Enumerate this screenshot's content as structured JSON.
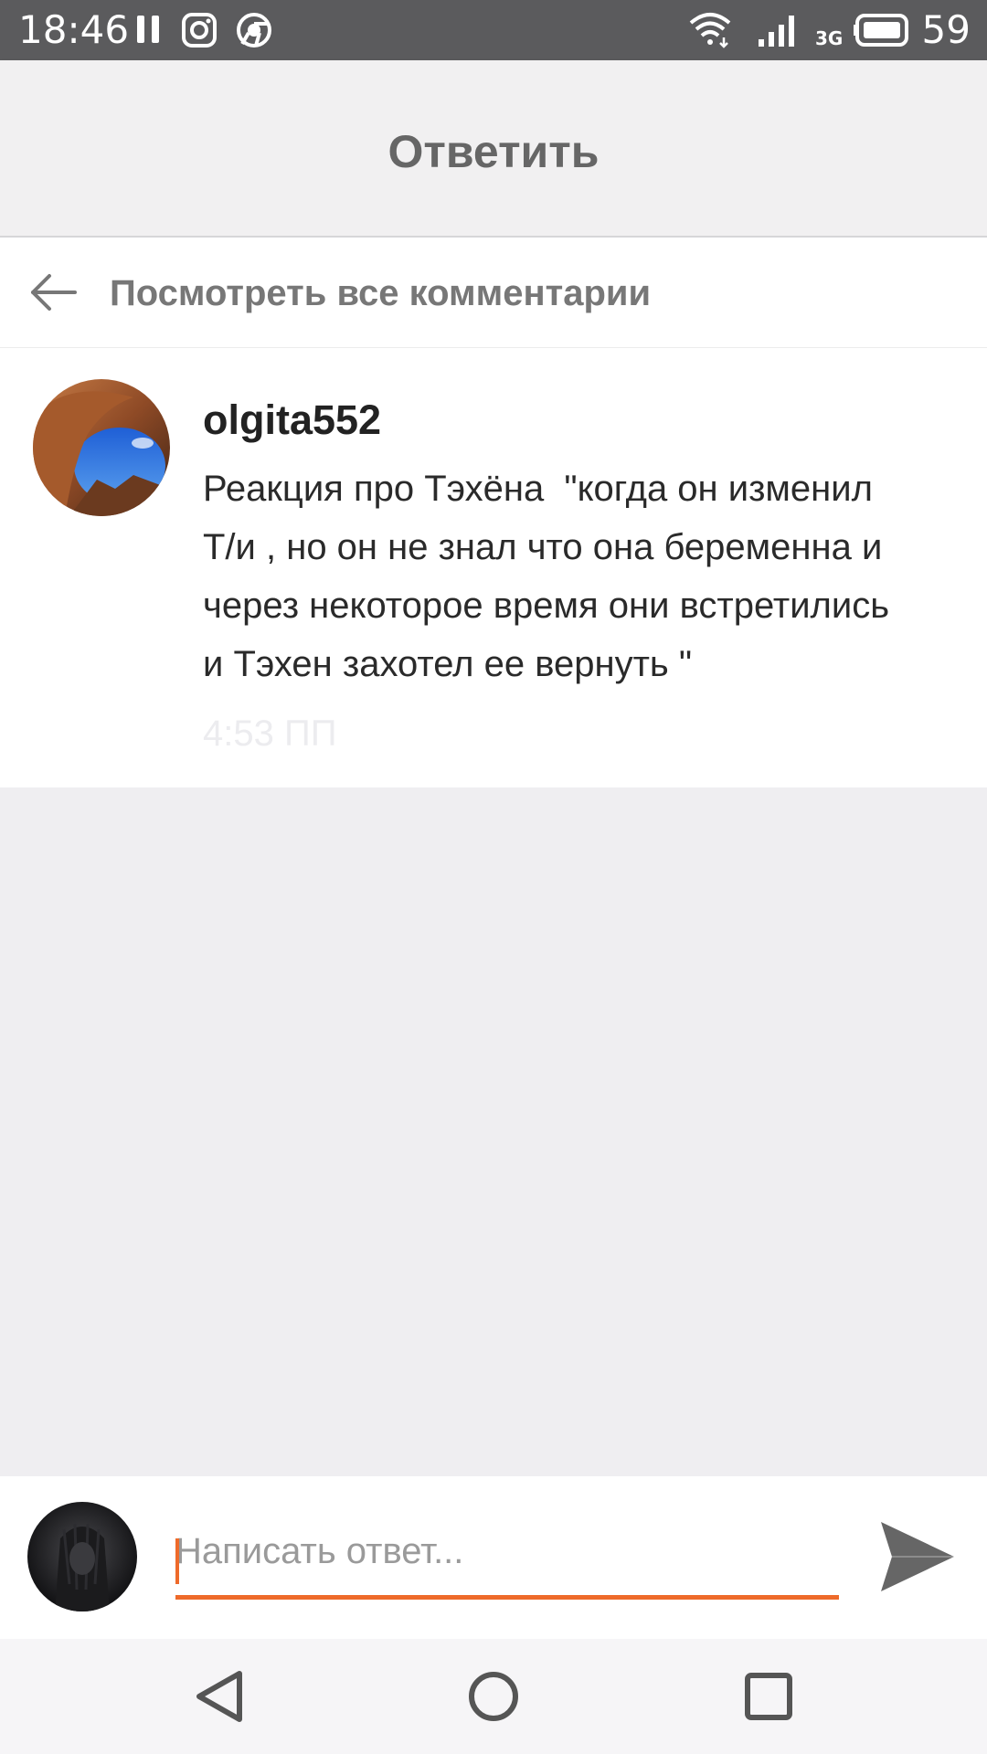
{
  "status_bar": {
    "time": "18:46",
    "network": "3G",
    "battery": "59",
    "icons": [
      "pause-icon",
      "instagram-icon",
      "chrome-icon",
      "wifi-icon",
      "signal-icon",
      "battery-icon"
    ]
  },
  "header": {
    "title": "Ответить"
  },
  "view_all": {
    "label": "Посмотреть все комментарии",
    "icon": "back-arrow-icon"
  },
  "comment": {
    "username": "olgita552",
    "text": "Реакция про Тэхёна  \"когда он изменил\nТ/и , но он не знал что она беременна и\nчерез некоторое время они встретились\nи Тэхен захотел ее вернуть \"",
    "time": "4:53 ПП"
  },
  "reply": {
    "placeholder": "Написать ответ...",
    "value": "",
    "icon": "send-icon"
  },
  "colors": {
    "accent": "#ee6a2a",
    "status_bar": "#5b5b5d",
    "header_bg": "#f1f0f1",
    "page_bg": "#efeef1"
  },
  "nav": {
    "icons": [
      "nav-back-icon",
      "nav-home-icon",
      "nav-recents-icon"
    ]
  }
}
